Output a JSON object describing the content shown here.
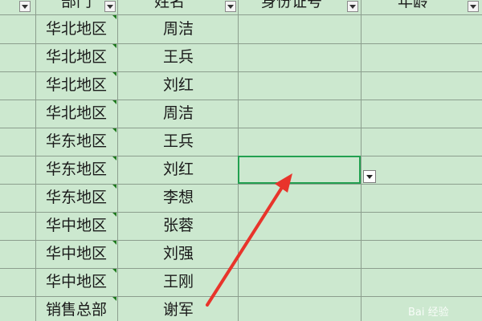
{
  "sheet": {
    "headers": {
      "dept": "部门",
      "name": "姓名",
      "id": "身份证号",
      "age": "年龄"
    },
    "rows": [
      {
        "dept": "华北地区",
        "name": "周洁"
      },
      {
        "dept": "华北地区",
        "name": "王兵"
      },
      {
        "dept": "华北地区",
        "name": "刘红"
      },
      {
        "dept": "华北地区",
        "name": "周洁"
      },
      {
        "dept": "华东地区",
        "name": "王兵"
      },
      {
        "dept": "华东地区",
        "name": "刘红"
      },
      {
        "dept": "华东地区",
        "name": "李想"
      },
      {
        "dept": "华中地区",
        "name": "张蓉"
      },
      {
        "dept": "华中地区",
        "name": "刘强"
      },
      {
        "dept": "华中地区",
        "name": "王刚"
      },
      {
        "dept": "销售总部",
        "name": "谢军"
      }
    ],
    "active_cell": {
      "column": "身份证号",
      "row_index": 5
    }
  },
  "icons": {
    "filter_button": "filter-dropdown-icon",
    "validation_dropdown": "dropdown-arrow-icon",
    "annotation": "red-arrow-icon"
  },
  "colors": {
    "cell_background": "#cce8cf",
    "gridline": "#8c9e8e",
    "selection_border": "#22a050",
    "annotation_arrow": "#e8342b"
  },
  "watermark": {
    "text": "Bai 经验"
  }
}
